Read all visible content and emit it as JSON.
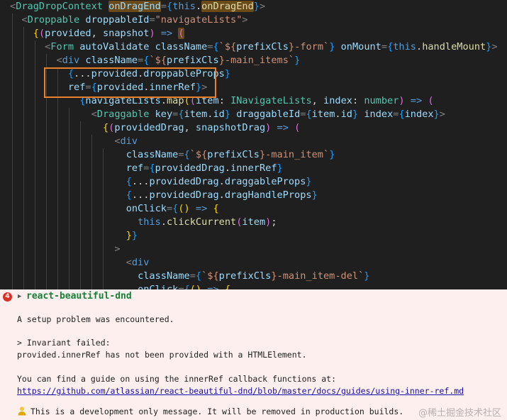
{
  "editor": {
    "lines": [
      [
        [
          "tk-punc",
          "<"
        ],
        [
          "tk-tag",
          "DragDropContext "
        ],
        [
          "tk-attr hl",
          "onDragEnd"
        ],
        [
          "tk-punc",
          "="
        ],
        [
          "tk-brace",
          "{"
        ],
        [
          "tk-kw",
          "this"
        ],
        [
          "tk-white",
          "."
        ],
        [
          "tk-fn hl",
          "onDragEnd"
        ],
        [
          "tk-brace",
          "}"
        ],
        [
          "tk-punc",
          ">"
        ]
      ],
      [
        [
          "tk-punc",
          "  <"
        ],
        [
          "tk-tag",
          "Droppable "
        ],
        [
          "tk-attr",
          "droppableId"
        ],
        [
          "tk-punc",
          "="
        ],
        [
          "tk-str",
          "\"navigateLists\""
        ],
        [
          "tk-punc",
          ">"
        ]
      ],
      [
        [
          "tk-white",
          "    "
        ],
        [
          "tk-gold",
          "{"
        ],
        [
          "tk-mag",
          "("
        ],
        [
          "tk-var",
          "provided"
        ],
        [
          "tk-white",
          ", "
        ],
        [
          "tk-var",
          "snapshot"
        ],
        [
          "tk-mag",
          ")"
        ],
        [
          "tk-white",
          " "
        ],
        [
          "tk-kw",
          "=>"
        ],
        [
          "tk-white",
          " "
        ],
        [
          "tk-mag hl",
          "("
        ]
      ],
      [
        [
          "tk-punc",
          "      <"
        ],
        [
          "tk-tag",
          "Form "
        ],
        [
          "tk-attr",
          "autoValidate "
        ],
        [
          "tk-attr",
          "className"
        ],
        [
          "tk-punc",
          "="
        ],
        [
          "tk-brace",
          "{"
        ],
        [
          "tk-str",
          "`${"
        ],
        [
          "tk-var",
          "prefixCls"
        ],
        [
          "tk-str",
          "}-form`"
        ],
        [
          "tk-brace",
          "}"
        ],
        [
          "tk-white",
          " "
        ],
        [
          "tk-attr",
          "onMount"
        ],
        [
          "tk-punc",
          "="
        ],
        [
          "tk-brace",
          "{"
        ],
        [
          "tk-kw",
          "this"
        ],
        [
          "tk-white",
          "."
        ],
        [
          "tk-fn",
          "handleMount"
        ],
        [
          "tk-brace",
          "}"
        ],
        [
          "tk-punc",
          ">"
        ]
      ],
      [
        [
          "tk-punc",
          "        <"
        ],
        [
          "tk-kw",
          "div "
        ],
        [
          "tk-attr",
          "className"
        ],
        [
          "tk-punc",
          "="
        ],
        [
          "tk-brace",
          "{"
        ],
        [
          "tk-str",
          "`${"
        ],
        [
          "tk-var",
          "prefixCls"
        ],
        [
          "tk-str",
          "}-main_items`"
        ],
        [
          "tk-brace",
          "}"
        ]
      ],
      [
        [
          "tk-white",
          "          "
        ],
        [
          "tk-brace",
          "{"
        ],
        [
          "tk-white",
          "..."
        ],
        [
          "tk-var",
          "provided"
        ],
        [
          "tk-white",
          "."
        ],
        [
          "tk-var",
          "droppableProps"
        ],
        [
          "tk-brace",
          "}"
        ]
      ],
      [
        [
          "tk-white",
          "          "
        ],
        [
          "tk-attr",
          "ref"
        ],
        [
          "tk-punc",
          "="
        ],
        [
          "tk-brace",
          "{"
        ],
        [
          "tk-var",
          "provided"
        ],
        [
          "tk-white",
          "."
        ],
        [
          "tk-var",
          "innerRef"
        ],
        [
          "tk-brace",
          "}"
        ],
        [
          "tk-punc",
          ">"
        ]
      ],
      [
        [
          "tk-white",
          "            "
        ],
        [
          "tk-brace",
          "{"
        ],
        [
          "tk-var",
          "navigateLists"
        ],
        [
          "tk-white",
          "."
        ],
        [
          "tk-fn",
          "map"
        ],
        [
          "tk-gold",
          "("
        ],
        [
          "tk-mag",
          "("
        ],
        [
          "tk-var",
          "item"
        ],
        [
          "tk-white",
          ": "
        ],
        [
          "tk-type",
          "INavigateLists"
        ],
        [
          "tk-white",
          ", "
        ],
        [
          "tk-var",
          "index"
        ],
        [
          "tk-white",
          ": "
        ],
        [
          "tk-type",
          "number"
        ],
        [
          "tk-mag",
          ")"
        ],
        [
          "tk-white",
          " "
        ],
        [
          "tk-kw",
          "=>"
        ],
        [
          "tk-white",
          " "
        ],
        [
          "tk-mag",
          "("
        ]
      ],
      [
        [
          "tk-punc",
          "              <"
        ],
        [
          "tk-tag",
          "Draggable "
        ],
        [
          "tk-attr",
          "key"
        ],
        [
          "tk-punc",
          "="
        ],
        [
          "tk-brace",
          "{"
        ],
        [
          "tk-var",
          "item"
        ],
        [
          "tk-white",
          "."
        ],
        [
          "tk-var",
          "id"
        ],
        [
          "tk-brace",
          "}"
        ],
        [
          "tk-white",
          " "
        ],
        [
          "tk-attr",
          "draggableId"
        ],
        [
          "tk-punc",
          "="
        ],
        [
          "tk-brace",
          "{"
        ],
        [
          "tk-var",
          "item"
        ],
        [
          "tk-white",
          "."
        ],
        [
          "tk-var",
          "id"
        ],
        [
          "tk-brace",
          "}"
        ],
        [
          "tk-white",
          " "
        ],
        [
          "tk-attr",
          "index"
        ],
        [
          "tk-punc",
          "="
        ],
        [
          "tk-brace",
          "{"
        ],
        [
          "tk-var",
          "index"
        ],
        [
          "tk-brace",
          "}"
        ],
        [
          "tk-punc",
          ">"
        ]
      ],
      [
        [
          "tk-white",
          "                "
        ],
        [
          "tk-gold",
          "{"
        ],
        [
          "tk-mag",
          "("
        ],
        [
          "tk-var",
          "providedDrag"
        ],
        [
          "tk-white",
          ", "
        ],
        [
          "tk-var",
          "snapshotDrag"
        ],
        [
          "tk-mag",
          ")"
        ],
        [
          "tk-white",
          " "
        ],
        [
          "tk-kw",
          "=>"
        ],
        [
          "tk-white",
          " "
        ],
        [
          "tk-mag",
          "("
        ]
      ],
      [
        [
          "tk-punc",
          "                  <"
        ],
        [
          "tk-kw",
          "div"
        ]
      ],
      [
        [
          "tk-white",
          "                    "
        ],
        [
          "tk-attr",
          "className"
        ],
        [
          "tk-punc",
          "="
        ],
        [
          "tk-brace",
          "{"
        ],
        [
          "tk-str",
          "`${"
        ],
        [
          "tk-var",
          "prefixCls"
        ],
        [
          "tk-str",
          "}-main_item`"
        ],
        [
          "tk-brace",
          "}"
        ]
      ],
      [
        [
          "tk-white",
          "                    "
        ],
        [
          "tk-attr",
          "ref"
        ],
        [
          "tk-punc",
          "="
        ],
        [
          "tk-brace",
          "{"
        ],
        [
          "tk-var",
          "providedDrag"
        ],
        [
          "tk-white",
          "."
        ],
        [
          "tk-var",
          "innerRef"
        ],
        [
          "tk-brace",
          "}"
        ]
      ],
      [
        [
          "tk-white",
          "                    "
        ],
        [
          "tk-brace",
          "{"
        ],
        [
          "tk-white",
          "..."
        ],
        [
          "tk-var",
          "providedDrag"
        ],
        [
          "tk-white",
          "."
        ],
        [
          "tk-var",
          "draggableProps"
        ],
        [
          "tk-brace",
          "}"
        ]
      ],
      [
        [
          "tk-white",
          "                    "
        ],
        [
          "tk-brace",
          "{"
        ],
        [
          "tk-white",
          "..."
        ],
        [
          "tk-var",
          "providedDrag"
        ],
        [
          "tk-white",
          "."
        ],
        [
          "tk-var",
          "dragHandleProps"
        ],
        [
          "tk-brace",
          "}"
        ]
      ],
      [
        [
          "tk-white",
          "                    "
        ],
        [
          "tk-attr",
          "onClick"
        ],
        [
          "tk-punc",
          "="
        ],
        [
          "tk-brace",
          "{"
        ],
        [
          "tk-gold",
          "()"
        ],
        [
          "tk-white",
          " "
        ],
        [
          "tk-kw",
          "=>"
        ],
        [
          "tk-white",
          " "
        ],
        [
          "tk-gold",
          "{"
        ]
      ],
      [
        [
          "tk-white",
          "                      "
        ],
        [
          "tk-kw",
          "this"
        ],
        [
          "tk-white",
          "."
        ],
        [
          "tk-fn",
          "clickCurrent"
        ],
        [
          "tk-mag",
          "("
        ],
        [
          "tk-var",
          "item"
        ],
        [
          "tk-mag",
          ")"
        ],
        [
          "tk-white",
          ";"
        ]
      ],
      [
        [
          "tk-white",
          "                    "
        ],
        [
          "tk-gold",
          "}"
        ],
        [
          "tk-brace",
          "}"
        ]
      ],
      [
        [
          "tk-punc",
          "                  >"
        ]
      ],
      [
        [
          "tk-punc",
          "                    <"
        ],
        [
          "tk-kw",
          "div"
        ]
      ],
      [
        [
          "tk-white",
          "                      "
        ],
        [
          "tk-attr",
          "className"
        ],
        [
          "tk-punc",
          "="
        ],
        [
          "tk-brace",
          "{"
        ],
        [
          "tk-str",
          "`${"
        ],
        [
          "tk-var",
          "prefixCls"
        ],
        [
          "tk-str",
          "}-main_item-del`"
        ],
        [
          "tk-brace",
          "}"
        ]
      ],
      [
        [
          "tk-white",
          "                      "
        ],
        [
          "tk-attr",
          "onClick"
        ],
        [
          "tk-punc",
          "="
        ],
        [
          "tk-brace",
          "{"
        ],
        [
          "tk-gold",
          "()"
        ],
        [
          "tk-white",
          " "
        ],
        [
          "tk-kw",
          "=>"
        ],
        [
          "tk-white",
          " "
        ],
        [
          "tk-gold",
          "{"
        ]
      ]
    ]
  },
  "console": {
    "error_count": "4",
    "library": "react-beautiful-dnd",
    "setup_problem": "A setup problem was encountered.",
    "invariant": "> Invariant failed:",
    "message": "provided.innerRef has not been provided with a HTMLElement.",
    "guide_intro": "You can find a guide on using the innerRef callback functions at:",
    "guide_link": "https://github.com/atlassian/react-beautiful-dnd/blob/master/docs/guides/using-inner-ref.md",
    "dev_note": "This is a development only message. It will be removed in production builds.",
    "watermark": "@稀土掘金技术社区"
  },
  "colors": {
    "highlight_box": "#e8812a",
    "error_badge": "#d93025",
    "library_name": "#188038",
    "console_bg": "#fcefee"
  }
}
